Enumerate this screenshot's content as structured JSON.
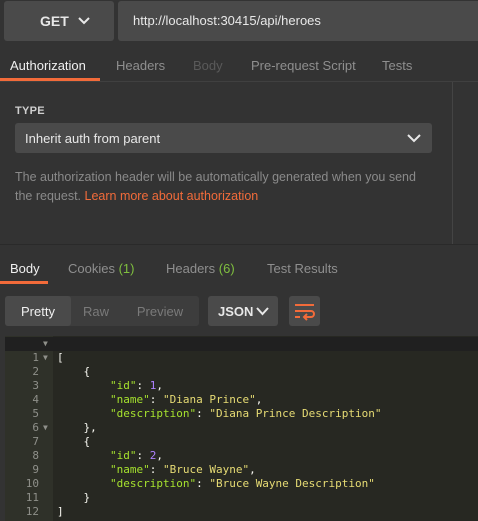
{
  "request": {
    "method": "GET",
    "url": "http://localhost:30415/api/heroes"
  },
  "request_tabs": [
    {
      "label": "Authorization",
      "state": "active"
    },
    {
      "label": "Headers",
      "state": "normal"
    },
    {
      "label": "Body",
      "state": "disabled"
    },
    {
      "label": "Pre-request Script",
      "state": "normal"
    },
    {
      "label": "Tests",
      "state": "normal"
    }
  ],
  "auth": {
    "type_label": "TYPE",
    "selected_type": "Inherit auth from parent",
    "description": "The authorization header will be automatically generated when you send the request. ",
    "learn_more": "Learn more about authorization"
  },
  "response_tabs": {
    "body": "Body",
    "cookies": "Cookies",
    "cookies_count": "(1)",
    "headers": "Headers",
    "headers_count": "(6)",
    "test_results": "Test Results"
  },
  "format": {
    "pretty": "Pretty",
    "raw": "Raw",
    "preview": "Preview",
    "language": "JSON"
  },
  "line_numbers": [
    "1",
    "2",
    "3",
    "4",
    "5",
    "6",
    "7",
    "8",
    "9",
    "10",
    "11",
    "12"
  ],
  "response_body": [
    {
      "id": 1,
      "name": "Diana Prince",
      "description": "Diana Prince Description"
    },
    {
      "id": 2,
      "name": "Bruce Wayne",
      "description": "Bruce Wayne Description"
    }
  ],
  "colors": {
    "accent": "#f26b3a",
    "count": "#7fbf3f",
    "json_key": "#a6e22e",
    "json_string": "#e6db74",
    "json_number": "#ae81ff"
  },
  "icons": {
    "method_dropdown": "chevron-down-icon",
    "auth_dropdown": "chevron-down-icon",
    "language_dropdown": "chevron-down-icon",
    "wrap": "wrap-lines-icon",
    "fold": "fold-triangle-icon"
  }
}
